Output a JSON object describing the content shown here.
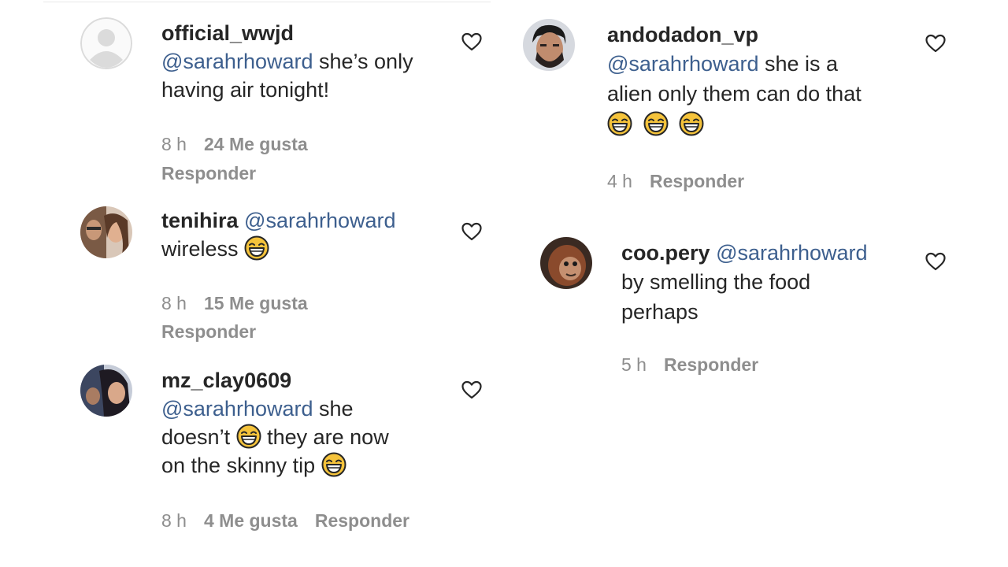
{
  "comments": [
    {
      "username": "official_wwjd",
      "mention": "@sarahrhoward",
      "text_line1": " she’s only",
      "text_line2": "having air tonight!",
      "time": "8 h",
      "likes": "24 Me gusta",
      "reply": "Responder"
    },
    {
      "username": "tenihira",
      "mention": "@sarahrhoward",
      "text_line2": "wireless",
      "time": "8 h",
      "likes": "15 Me gusta",
      "reply": "Responder"
    },
    {
      "username": "mz_clay0609",
      "mention": "@sarahrhoward",
      "text_line1": " she",
      "text_line2a": "doesn’t",
      "text_line2b": " they are now",
      "text_line3": "on the skinny tip",
      "time": "8 h",
      "likes": "4 Me gusta",
      "reply": "Responder"
    },
    {
      "username": "andodadon_vp",
      "mention": "@sarahrhoward",
      "text_line1": " she is a",
      "text_line2": "alien only them can do that",
      "time": "4 h",
      "reply": "Responder"
    },
    {
      "username": "coo.pery",
      "mention": "@sarahrhoward",
      "text_line2": "by smelling the food",
      "text_line3": "perhaps",
      "time": "5 h",
      "reply": "Responder"
    }
  ],
  "icons": {
    "like": "heart-outline-icon",
    "emoji": "face-with-tears-of-joy-emoji",
    "default_avatar": "default-avatar-icon"
  },
  "colors": {
    "mention": "#3d5f8e",
    "meta": "#8e8e8e",
    "text": "#262626"
  }
}
